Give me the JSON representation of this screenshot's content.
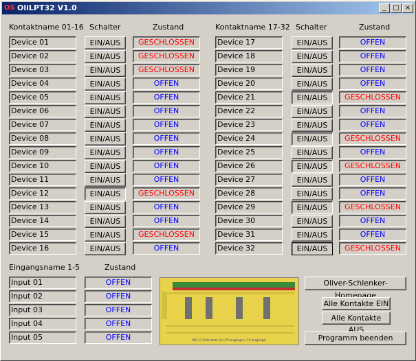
{
  "window": {
    "title": "OliLPT32 V1.0",
    "icon_label": "OS"
  },
  "titlebar_buttons": {
    "minimize": "_",
    "maximize": "□",
    "close": "×"
  },
  "headers": {
    "name_left": "Kontaktname 01-16",
    "switch_left": "Schalter",
    "state_left": "Zustand",
    "name_right": "Kontaktname 17-32",
    "switch_right": "Schalter",
    "state_right": "Zustand",
    "input_name": "Eingangsname 1-5",
    "input_state": "Zustand"
  },
  "switch_label": "EIN/AUS",
  "devices": [
    {
      "name": "Device 01",
      "state": "GESCHLOSSEN"
    },
    {
      "name": "Device 02",
      "state": "GESCHLOSSEN"
    },
    {
      "name": "Device 03",
      "state": "GESCHLOSSEN"
    },
    {
      "name": "Device 04",
      "state": "OFFEN"
    },
    {
      "name": "Device 05",
      "state": "OFFEN"
    },
    {
      "name": "Device 06",
      "state": "OFFEN"
    },
    {
      "name": "Device 07",
      "state": "OFFEN"
    },
    {
      "name": "Device 08",
      "state": "OFFEN"
    },
    {
      "name": "Device 09",
      "state": "OFFEN"
    },
    {
      "name": "Device 10",
      "state": "OFFEN"
    },
    {
      "name": "Device 11",
      "state": "OFFEN"
    },
    {
      "name": "Device 12",
      "state": "GESCHLOSSEN"
    },
    {
      "name": "Device 13",
      "state": "OFFEN"
    },
    {
      "name": "Device 14",
      "state": "OFFEN"
    },
    {
      "name": "Device 15",
      "state": "GESCHLOSSEN"
    },
    {
      "name": "Device 16",
      "state": "OFFEN"
    },
    {
      "name": "Device 17",
      "state": "OFFEN"
    },
    {
      "name": "Device 18",
      "state": "OFFEN"
    },
    {
      "name": "Device 19",
      "state": "OFFEN"
    },
    {
      "name": "Device 20",
      "state": "OFFEN"
    },
    {
      "name": "Device 21",
      "state": "GESCHLOSSEN"
    },
    {
      "name": "Device 22",
      "state": "OFFEN"
    },
    {
      "name": "Device 23",
      "state": "OFFEN"
    },
    {
      "name": "Device 24",
      "state": "GESCHLOSSEN"
    },
    {
      "name": "Device 25",
      "state": "OFFEN"
    },
    {
      "name": "Device 26",
      "state": "GESCHLOSSEN"
    },
    {
      "name": "Device 27",
      "state": "OFFEN"
    },
    {
      "name": "Device 28",
      "state": "OFFEN"
    },
    {
      "name": "Device 29",
      "state": "GESCHLOSSEN"
    },
    {
      "name": "Device 30",
      "state": "OFFEN"
    },
    {
      "name": "Device 31",
      "state": "OFFEN"
    },
    {
      "name": "Device 32",
      "state": "GESCHLOSSEN"
    }
  ],
  "inputs": [
    {
      "name": "Input 01",
      "state": "OFFEN"
    },
    {
      "name": "Input 02",
      "state": "OFFEN"
    },
    {
      "name": "Input 03",
      "state": "OFFEN"
    },
    {
      "name": "Input 04",
      "state": "OFFEN"
    },
    {
      "name": "Input 05",
      "state": "OFFEN"
    }
  ],
  "buttons": {
    "homepage": "Oliver-Schlenker-Homepage",
    "all_on": "Alle Kontakte EIN",
    "all_off": "Alle Kontakte AUS",
    "quit": "Programm beenden"
  },
  "board_caption": "OliR v1 Relaiskarte für LPT-Ausgänge (+16 Ausgänge)",
  "colors": {
    "open": "#0000ff",
    "closed": "#ff0000",
    "title_start": "#0a246a",
    "title_end": "#a6caf0",
    "board": "#e8d24a"
  }
}
